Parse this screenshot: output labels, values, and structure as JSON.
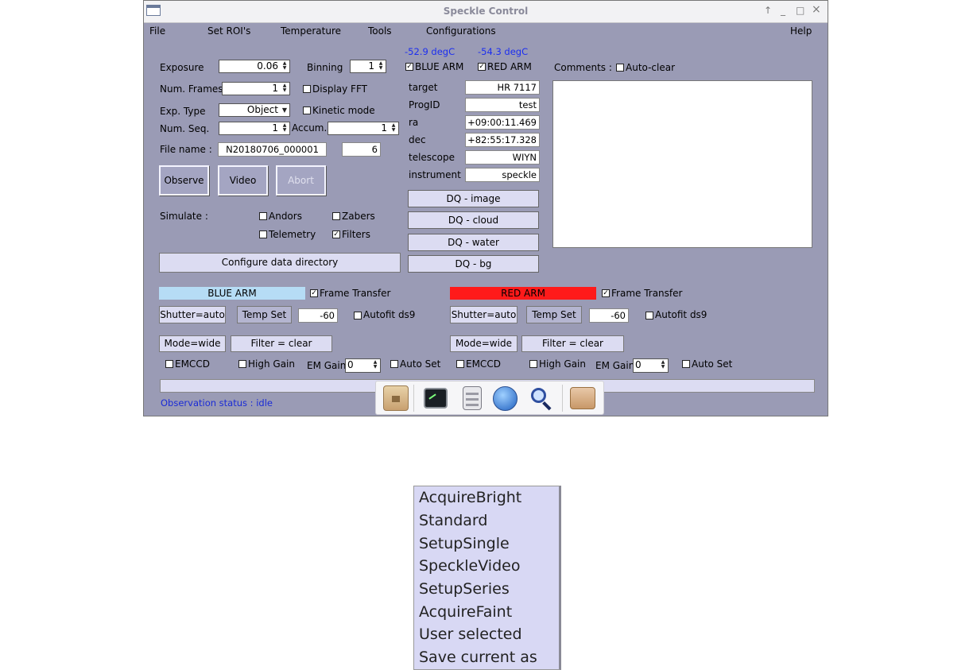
{
  "window": {
    "title": "Speckle Control",
    "controls": [
      "↑",
      "_",
      "□",
      "×"
    ]
  },
  "menu": {
    "file": "File",
    "set_rois": "Set ROI's",
    "temperature": "Temperature",
    "tools": "Tools",
    "configurations": "Configurations",
    "help": "Help"
  },
  "temps": {
    "blue": "-52.9 degC",
    "red": "-54.3 degC"
  },
  "arms": {
    "blue_label": "BLUE ARM",
    "red_label": "RED ARM",
    "blue_checked": true,
    "red_checked": true
  },
  "exposure": {
    "label": "Exposure",
    "value": "0.06"
  },
  "binning": {
    "label": "Binning",
    "value": "1"
  },
  "num_frames": {
    "label": "Num. Frames",
    "value": "1"
  },
  "display_fft": {
    "label": "Display FFT",
    "checked": false
  },
  "exp_type": {
    "label": "Exp. Type",
    "value": "Object"
  },
  "kinetic_mode": {
    "label": "Kinetic mode",
    "checked": false
  },
  "num_seq": {
    "label": "Num. Seq.",
    "value": "1"
  },
  "accum": {
    "label": "Accum.",
    "value": "1"
  },
  "file_name": {
    "label": "File name :",
    "value": "N20180706_000001",
    "index": "6"
  },
  "buttons": {
    "observe": "Observe",
    "video": "Video",
    "abort": "Abort"
  },
  "simulate": {
    "label": "Simulate :",
    "andors": "Andors",
    "zabers": "Zabers",
    "telemetry": "Telemetry",
    "filters": "Filters",
    "filters_checked": true
  },
  "configure_dir": "Configure data directory",
  "target_info": {
    "target_label": "target",
    "target": "HR 7117",
    "progid_label": "ProgID",
    "progid": "test",
    "ra_label": "ra",
    "ra": "+09:00:11.469",
    "dec_label": "dec",
    "dec": "+82:55:17.328",
    "telescope_label": "telescope",
    "telescope": "WIYN",
    "instrument_label": "instrument",
    "instrument": "speckle"
  },
  "dq": {
    "image": "DQ - image",
    "cloud": "DQ - cloud",
    "water": "DQ - water",
    "bg": "DQ - bg"
  },
  "comments": {
    "label": "Comments :",
    "autoclear": "Auto-clear"
  },
  "blue_arm": {
    "title": "BLUE ARM",
    "color": "#b6dcf5",
    "frame_transfer": "Frame Transfer",
    "shutter": "Shutter=auto",
    "temp_set": "Temp Set",
    "temp_value": "-60",
    "autofit": "Autofit ds9",
    "mode": "Mode=wide",
    "filter": "Filter = clear",
    "emccd": "EMCCD",
    "high_gain": "High Gain",
    "em_gain": "EM Gain",
    "em_gain_value": "0",
    "auto_set": "Auto Set"
  },
  "red_arm": {
    "title": "RED ARM",
    "color": "#ff1a1a",
    "frame_transfer": "Frame Transfer",
    "shutter": "Shutter=auto",
    "temp_set": "Temp Set",
    "temp_value": "-60",
    "autofit": "Autofit ds9",
    "mode": "Mode=wide",
    "filter": "Filter = clear",
    "emccd": "EMCCD",
    "high_gain": "High Gain",
    "em_gain": "EM Gain",
    "em_gain_value": "0",
    "auto_set": "Auto Set"
  },
  "status": {
    "text": "Observation status : idle"
  },
  "dock": [
    "home-folder-icon",
    "terminal-icon",
    "file-manager-icon",
    "web-browser-icon",
    "search-icon",
    "folder-icon"
  ],
  "popup_menu": {
    "items": [
      "AcquireBright",
      "Standard",
      "SetupSingle",
      "SpeckleVideo",
      "SetupSeries",
      "AcquireFaint",
      "User selected",
      "Save current as"
    ]
  }
}
